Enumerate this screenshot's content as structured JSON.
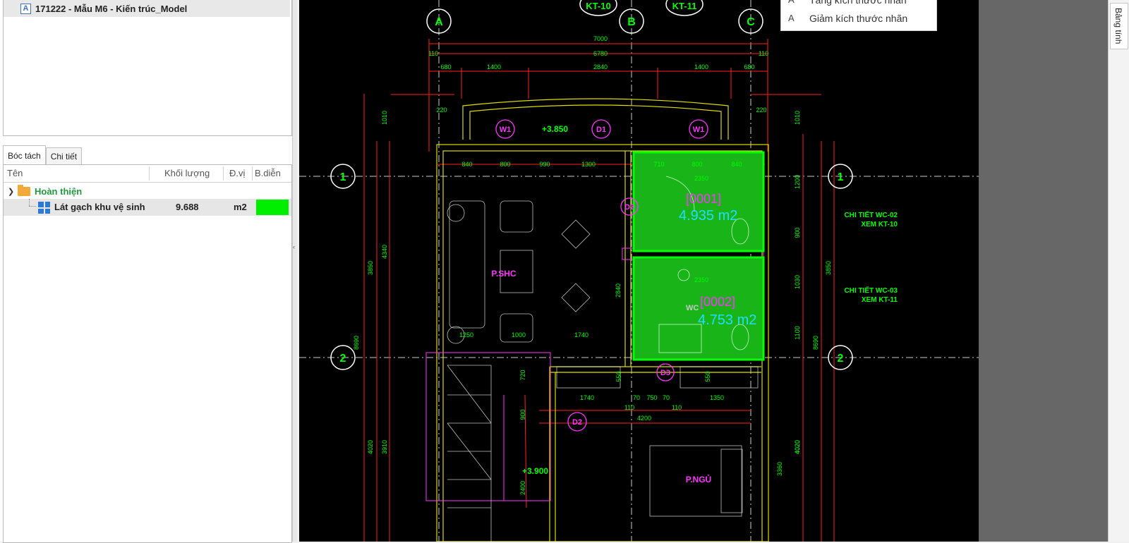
{
  "project": {
    "icon_letter": "A",
    "name": "171222 - Mẫu M6 - Kiến trúc_Model"
  },
  "tabs": [
    {
      "label": "Bóc tách"
    },
    {
      "label": "Chi tiết"
    }
  ],
  "grid": {
    "columns": [
      "Tên",
      "Khối lượng",
      "Đ.vị",
      "B.diễn"
    ],
    "group": {
      "label": "Hoàn thiện"
    },
    "rows": [
      {
        "name": "Lát gạch khu vệ sinh",
        "qty": "9.688",
        "unit": "m2",
        "color": "#00ee00"
      }
    ]
  },
  "context_menu": {
    "items": [
      {
        "icon": "A",
        "label": "Tăng kích thước nhãn"
      },
      {
        "icon": "A",
        "label": "Giảm kích thước nhãn"
      }
    ]
  },
  "right_tab": {
    "label": "Bảng tính"
  },
  "splitter_glyph": "‹",
  "cad": {
    "grid_labels": [
      "A",
      "B",
      "C",
      "1",
      "1",
      "2",
      "2"
    ],
    "callouts": [
      "KT-10",
      "KT-11"
    ],
    "dims": [
      "7000",
      "6780",
      "110",
      "110",
      "680",
      "1400",
      "2840",
      "1400",
      "680",
      "220",
      "220",
      "840",
      "800",
      "990",
      "1300",
      "710",
      "800",
      "840",
      "2350",
      "2350",
      "1250",
      "1000",
      "1740",
      "1740",
      "750",
      "1350",
      "110",
      "110",
      "4200",
      "8690",
      "8690",
      "3850",
      "3850",
      "4340",
      "4020",
      "3910",
      "4020",
      "3360",
      "1010",
      "1010",
      "720",
      "900",
      "2400",
      "2840",
      "550",
      "550",
      "70",
      "70",
      "4020",
      "1200",
      "900",
      "1030",
      "1100"
    ],
    "tags": [
      "W1",
      "D1",
      "W1",
      "D3",
      "D3",
      "D2"
    ],
    "levels": [
      "+3.850",
      "+3.900"
    ],
    "rooms": [
      "P.SHC",
      "P.NGỦ",
      "WC"
    ],
    "area_codes": [
      "[0001]",
      "[0002]"
    ],
    "areas": [
      "4.935 m2",
      "4.753 m2"
    ],
    "notes": [
      "CHI TIẾT WC-02",
      "XEM KT-10",
      "CHI TIẾT WC-03",
      "XEM KT-11"
    ]
  },
  "colors": {
    "accent": "#00ee00",
    "cad_bg": "#000000",
    "group_text": "#1e9a3c",
    "dim": "#ff2020",
    "grid": "#00ff00",
    "magenta": "#ff33ff",
    "cyan": "#22ddff"
  }
}
